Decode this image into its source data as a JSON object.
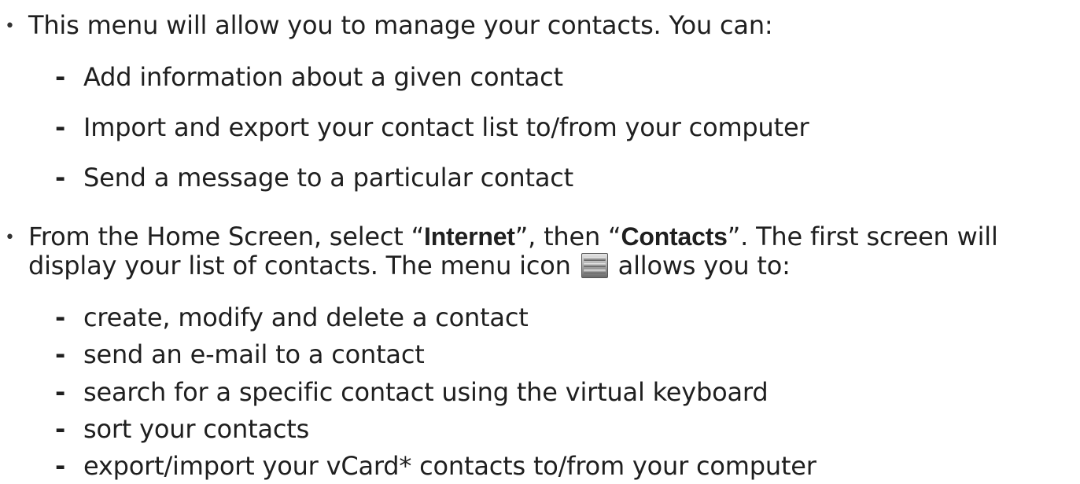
{
  "bullet1": {
    "text": "This menu will allow you to manage your contacts. You can:",
    "items": [
      "Add information about a given contact",
      "Import and export your contact list to/from your computer",
      "Send a message to a particular contact"
    ]
  },
  "bullet2": {
    "part1": "From the Home Screen, select “",
    "bold1": "Internet",
    "part2": "”, then “",
    "bold2": "Contacts",
    "part3": "”. The first screen will display your list of contacts. The menu icon ",
    "part4": " allows you to:",
    "menu_icon": "menu-icon",
    "items": [
      "create, modify and delete a contact",
      "send an e-mail to a contact",
      "search for a specific contact using the virtual keyboard",
      "sort your contacts",
      "export/import your vCard* contacts to/from your computer"
    ]
  },
  "glyphs": {
    "bullet": "•",
    "dash": "-"
  }
}
